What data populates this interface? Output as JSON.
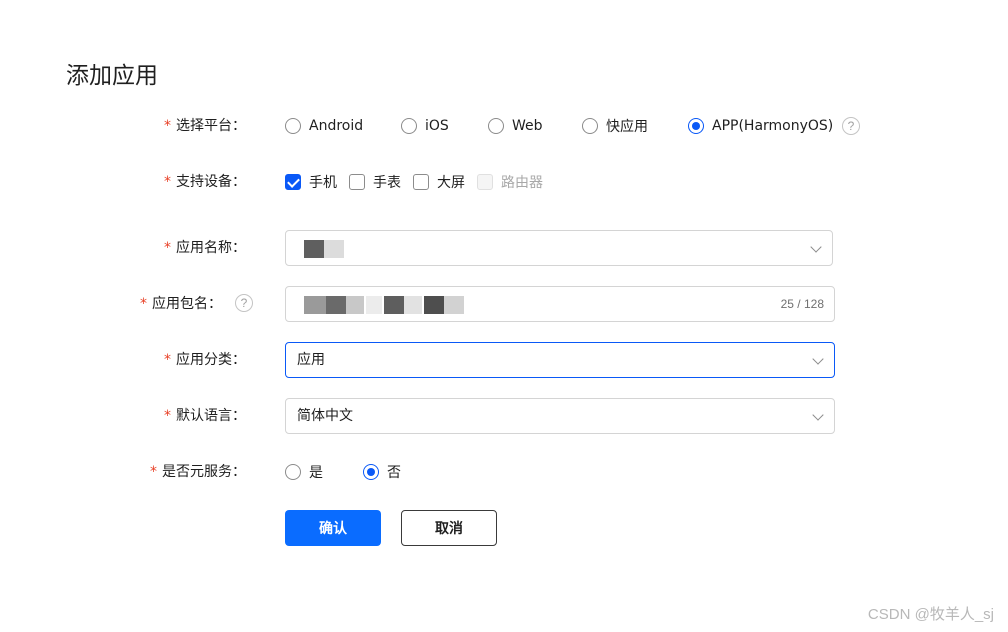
{
  "page": {
    "title": "添加应用"
  },
  "platform": {
    "label": "选择平台：",
    "options": [
      {
        "label": "Android",
        "checked": false
      },
      {
        "label": "iOS",
        "checked": false
      },
      {
        "label": "Web",
        "checked": false
      },
      {
        "label": "快应用",
        "checked": false
      },
      {
        "label": "APP(HarmonyOS)",
        "checked": true
      }
    ],
    "help": "?"
  },
  "devices": {
    "label": "支持设备：",
    "options": [
      {
        "label": "手机",
        "checked": true,
        "disabled": false
      },
      {
        "label": "手表",
        "checked": false,
        "disabled": false
      },
      {
        "label": "大屏",
        "checked": false,
        "disabled": false
      },
      {
        "label": "路由器",
        "checked": false,
        "disabled": true
      }
    ]
  },
  "app_name": {
    "label": "应用名称："
  },
  "package_name": {
    "label": "应用包名：",
    "help": "?",
    "counter": "25 / 128"
  },
  "category": {
    "label": "应用分类：",
    "value": "应用"
  },
  "language": {
    "label": "默认语言：",
    "value": "简体中文"
  },
  "atomic_service": {
    "label": "是否元服务：",
    "options": [
      {
        "label": "是",
        "checked": false
      },
      {
        "label": "否",
        "checked": true
      }
    ]
  },
  "actions": {
    "confirm": "确认",
    "cancel": "取消"
  },
  "watermark": "CSDN @牧羊人_sj",
  "colors": {
    "accent": "#0a59f7",
    "required": "#e84026",
    "button": "#0a6cff"
  }
}
